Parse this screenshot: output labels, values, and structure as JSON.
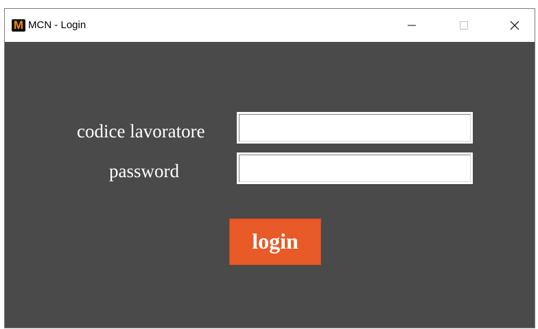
{
  "window": {
    "title": "MCN - Login",
    "app_icon_letter": "M",
    "controls": {
      "minimize_icon": "minimize-icon",
      "maximize_icon": "maximize-icon",
      "close_icon": "close-icon"
    }
  },
  "form": {
    "user_label": "codice lavoratore",
    "user_value": "",
    "password_label": "password",
    "password_value": "",
    "login_label": "login"
  },
  "colors": {
    "background": "#4a4a4a",
    "login_button": "#e85a27",
    "label_text": "#ffffff"
  }
}
